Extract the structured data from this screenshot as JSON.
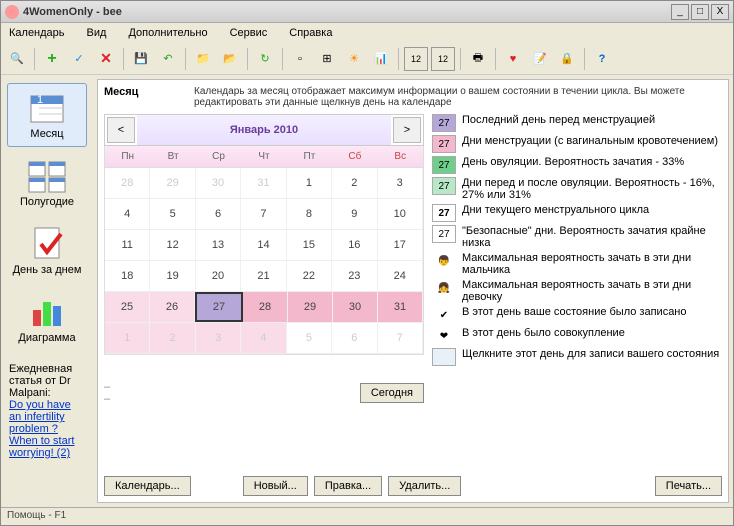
{
  "window": {
    "title": "4WomenOnly - bee"
  },
  "menu": {
    "items": [
      "Календарь",
      "Вид",
      "Дополнительно",
      "Сервис",
      "Справка"
    ]
  },
  "sidebar": {
    "nav": [
      {
        "label": "Месяц"
      },
      {
        "label": "Полугодие"
      },
      {
        "label": "День за днем"
      },
      {
        "label": "Диаграмма"
      }
    ],
    "links": {
      "intro": "Ежедневная статья от Dr Malpani:",
      "l1": "Do you have an infertility problem ?",
      "l2": "When to start worrying! (2)"
    }
  },
  "main": {
    "title": "Месяц",
    "desc": "Календарь за месяц отображает максимум информации о вашем состоянии в течении цикла. Вы можете редактировать эти данные щелкнув день на календаре",
    "month": "Январь 2010",
    "days": [
      "Пн",
      "Вт",
      "Ср",
      "Чт",
      "Пт",
      "Сб",
      "Вс"
    ],
    "weeks": [
      [
        {
          "n": "28",
          "cls": "dim"
        },
        {
          "n": "29",
          "cls": "dim"
        },
        {
          "n": "30",
          "cls": "dim"
        },
        {
          "n": "31",
          "cls": "dim"
        },
        {
          "n": "1",
          "cls": ""
        },
        {
          "n": "2",
          "cls": ""
        },
        {
          "n": "3",
          "cls": ""
        }
      ],
      [
        {
          "n": "4"
        },
        {
          "n": "5"
        },
        {
          "n": "6"
        },
        {
          "n": "7"
        },
        {
          "n": "8"
        },
        {
          "n": "9"
        },
        {
          "n": "10"
        }
      ],
      [
        {
          "n": "11"
        },
        {
          "n": "12"
        },
        {
          "n": "13"
        },
        {
          "n": "14"
        },
        {
          "n": "15"
        },
        {
          "n": "16"
        },
        {
          "n": "17"
        }
      ],
      [
        {
          "n": "18"
        },
        {
          "n": "19"
        },
        {
          "n": "20"
        },
        {
          "n": "21"
        },
        {
          "n": "22"
        },
        {
          "n": "23"
        },
        {
          "n": "24"
        }
      ],
      [
        {
          "n": "25",
          "cls": "lpink"
        },
        {
          "n": "26",
          "cls": "lpink"
        },
        {
          "n": "27",
          "cls": "sel"
        },
        {
          "n": "28",
          "cls": "pink"
        },
        {
          "n": "29",
          "cls": "pink"
        },
        {
          "n": "30",
          "cls": "pink"
        },
        {
          "n": "31",
          "cls": "pink"
        }
      ],
      [
        {
          "n": "1",
          "cls": "dim lpink"
        },
        {
          "n": "2",
          "cls": "dim lpink"
        },
        {
          "n": "3",
          "cls": "dim lpink"
        },
        {
          "n": "4",
          "cls": "dim lpink"
        },
        {
          "n": "5",
          "cls": "dim"
        },
        {
          "n": "6",
          "cls": "dim"
        },
        {
          "n": "7",
          "cls": "dim"
        }
      ]
    ],
    "todayBtn": "Сегодня",
    "dash": "–"
  },
  "legend": [
    {
      "box": "27",
      "bg": "#b5a8d8",
      "txt": "Последний день перед менструацией"
    },
    {
      "box": "27",
      "bg": "#f4b8cc",
      "txt": "Дни менструации (с вагинальным кровотечением)"
    },
    {
      "box": "27",
      "bg": "#6fcf8a",
      "txt": "День овуляции. Вероятность зачатия - 33%"
    },
    {
      "box": "27",
      "bg": "#b8e8c8",
      "txt": "Дни перед и после овуляции. Вероятность - 16%, 27% или 31%"
    },
    {
      "box": "27",
      "bg": "#fff",
      "bold": true,
      "txt": "Дни текущего менструального цикла"
    },
    {
      "box": "27",
      "bg": "#fff",
      "txt": "\"Безопасные\" дни. Вероятность зачатия крайне низка"
    },
    {
      "box": "",
      "bg": "#fff",
      "icon": "boy",
      "txt": "Максимальная вероятность зачать в эти дни мальчика"
    },
    {
      "box": "",
      "bg": "#fff",
      "icon": "girl",
      "txt": "Максимальная вероятность зачать в эти дни девочку"
    },
    {
      "box": "",
      "bg": "#fff",
      "icon": "check",
      "txt": "В этот день ваше состояние было записано"
    },
    {
      "box": "",
      "bg": "#fff",
      "icon": "heart",
      "txt": "В этот день было совокупление"
    },
    {
      "box": "",
      "bg": "#e8f0f8",
      "txt": "Щелкните этот день для записи вашего состояния"
    }
  ],
  "buttons": {
    "cal": "Календарь...",
    "new": "Новый...",
    "edit": "Правка...",
    "del": "Удалить...",
    "print": "Печать..."
  },
  "status": "Помощь - F1"
}
